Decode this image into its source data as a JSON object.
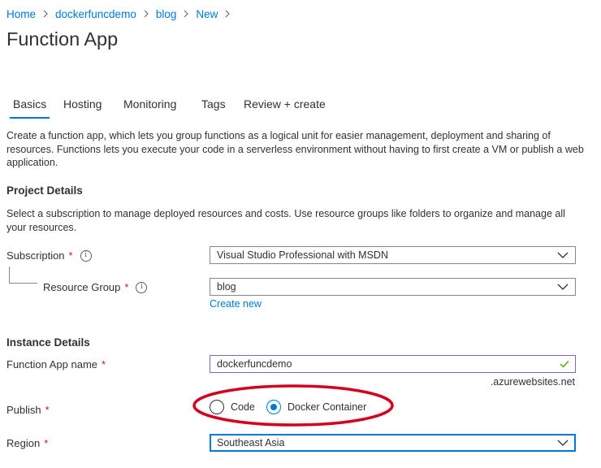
{
  "breadcrumb": [
    "Home",
    "dockerfuncdemo",
    "blog",
    "New"
  ],
  "page_title": "Function App",
  "tabs": [
    "Basics",
    "Hosting",
    "Monitoring",
    "Tags",
    "Review + create"
  ],
  "active_tab": "Basics",
  "intro": "Create a function app, which lets you group functions as a logical unit for easier management, deployment and sharing of resources. Functions lets you execute your code in a serverless environment without having to first create a VM or publish a web application.",
  "project_details": {
    "title": "Project Details",
    "description": "Select a subscription to manage deployed resources and costs. Use resource groups like folders to organize and manage all your resources.",
    "subscription_label": "Subscription",
    "subscription_value": "Visual Studio Professional with MSDN",
    "resource_group_label": "Resource Group",
    "resource_group_value": "blog",
    "create_new": "Create new"
  },
  "instance_details": {
    "title": "Instance Details",
    "app_name_label": "Function App name",
    "app_name_value": "dockerfuncdemo",
    "domain_suffix": ".azurewebsites.net",
    "publish_label": "Publish",
    "publish_options": [
      "Code",
      "Docker Container"
    ],
    "publish_selected": "Docker Container",
    "region_label": "Region",
    "region_value": "Southeast Asia"
  },
  "required_marker": "*",
  "info_glyph": "i",
  "colors": {
    "accent": "#0078d4",
    "required": "#a4262c",
    "annotation": "#d2001f",
    "valid_check": "#57a300"
  }
}
